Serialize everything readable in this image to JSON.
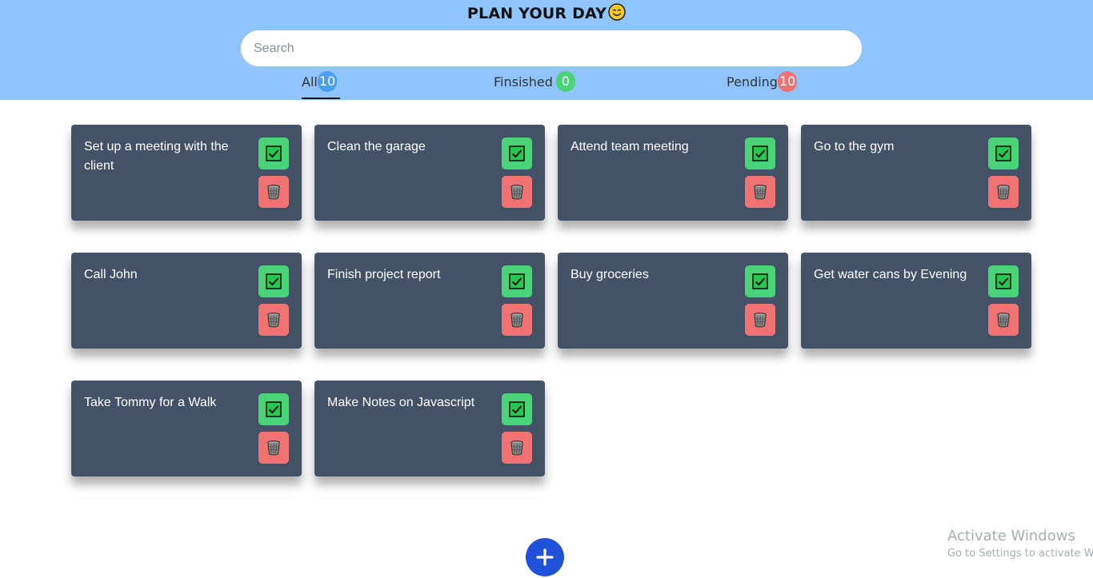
{
  "header": {
    "title": "PLAN YOUR DAY",
    "title_icon": "smiley-icon",
    "search_placeholder": "Search",
    "background_color": "#90c4fc"
  },
  "tabs": [
    {
      "label": "All",
      "count": "10",
      "badge_color": "#4a9ff5",
      "active": true
    },
    {
      "label": "Finsished",
      "count": "0",
      "badge_color": "#4ad379",
      "active": false
    },
    {
      "label": "Pending",
      "count": "10",
      "badge_color": "#f07272",
      "active": false
    }
  ],
  "tasks": [
    {
      "text": "Set up a meeting with the client"
    },
    {
      "text": "Clean the garage"
    },
    {
      "text": "Attend team meeting"
    },
    {
      "text": "Go to the gym"
    },
    {
      "text": "Call John"
    },
    {
      "text": "Finish project report"
    },
    {
      "text": "Buy groceries"
    },
    {
      "text": "Get water cans by Evening"
    },
    {
      "text": "Take Tommy for a Walk"
    },
    {
      "text": "Make Notes on Javascript"
    }
  ],
  "task_actions": {
    "done_icon": "checkbox-checked-icon",
    "delete_icon": "trash-icon"
  },
  "colors": {
    "card": "#435267",
    "done": "#4ad379",
    "delete": "#f07272",
    "add": "#1f52d8"
  },
  "add_button_icon": "plus-icon",
  "watermark": {
    "line1": "Activate Windows",
    "line2": "Go to Settings to activate W"
  }
}
